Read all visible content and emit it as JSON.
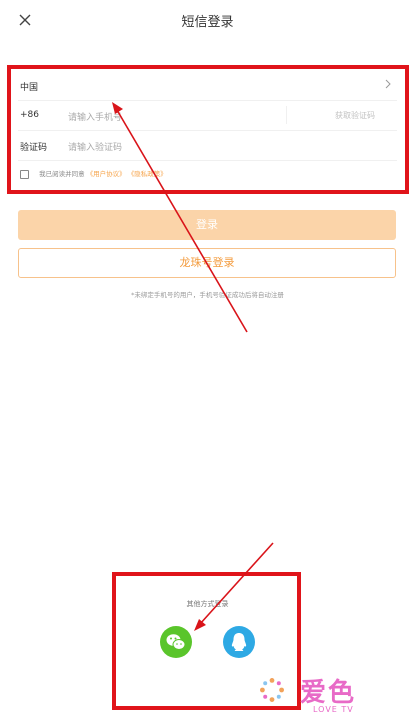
{
  "header": {
    "title": "短信登录",
    "close_icon": "close-icon"
  },
  "form": {
    "country": {
      "label": "中国",
      "icon": "chevron-right-icon"
    },
    "phone": {
      "prefix": "+86",
      "placeholder": "请输入手机号",
      "get_code_label": "获取验证码"
    },
    "code": {
      "label": "验证码",
      "placeholder": "请输入验证码"
    },
    "agreement": {
      "prefix": "我已阅读并同意",
      "user_agreement": "《用户协议》",
      "privacy_policy": "《隐私政策》"
    }
  },
  "buttons": {
    "login": "登录",
    "longzhu_login": "龙珠号登录"
  },
  "note": "*未绑定手机号的用户，手机号验证成功后将自动注册",
  "other_login": {
    "title": "其他方式登录",
    "options": [
      {
        "name": "wechat",
        "icon": "wechat-icon",
        "color": "#5ac52b"
      },
      {
        "name": "qq",
        "icon": "qq-icon",
        "color": "#2ea9e4"
      }
    ]
  },
  "annotations": {
    "box_color": "#e0141a",
    "arrow_color": "#d9141a"
  },
  "watermark": {
    "text": "爱色",
    "sub": "LOVE TV"
  },
  "colors": {
    "accent": "#f39b3d",
    "login_disabled": "#fbd4a9"
  }
}
